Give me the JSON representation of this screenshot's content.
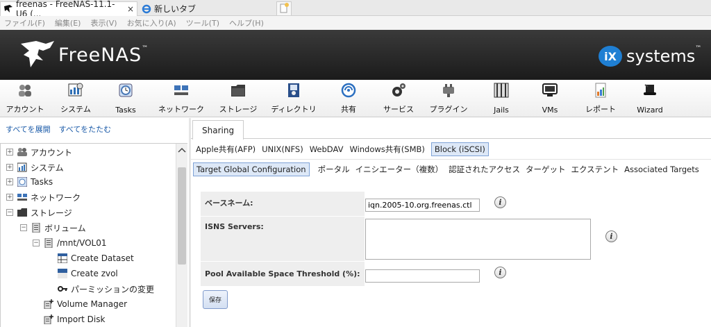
{
  "browser": {
    "tabs": [
      {
        "title": "freenas - FreeNAS-11.1-U6 (...",
        "close": "×"
      },
      {
        "title": "新しいタブ"
      }
    ],
    "menu": [
      "ファイル(F)",
      "編集(E)",
      "表示(V)",
      "お気に入り(A)",
      "ツール(T)",
      "ヘルプ(H)"
    ]
  },
  "header": {
    "logo_text": "FreeNAS",
    "tm": "™",
    "brand_ix": "iX",
    "brand_text": "systems",
    "brand_tm": "™"
  },
  "toolbar": {
    "buttons": [
      {
        "label": "アカウント",
        "icon": "users-icon"
      },
      {
        "label": "システム",
        "icon": "system-icon"
      },
      {
        "label": "Tasks",
        "icon": "tasks-icon"
      },
      {
        "label": "ネットワーク",
        "icon": "network-icon"
      },
      {
        "label": "ストレージ",
        "icon": "storage-icon"
      },
      {
        "label": "ディレクトリ",
        "icon": "directory-icon"
      },
      {
        "label": "共有",
        "icon": "sharing-icon"
      },
      {
        "label": "サービス",
        "icon": "services-icon"
      },
      {
        "label": "プラグイン",
        "icon": "plugins-icon"
      },
      {
        "label": "Jails",
        "icon": "jails-icon"
      },
      {
        "label": "VMs",
        "icon": "vms-icon"
      },
      {
        "label": "レポート",
        "icon": "reports-icon"
      },
      {
        "label": "Wizard",
        "icon": "wizard-icon"
      }
    ]
  },
  "sidebar": {
    "expand_all": "すべてを展開",
    "collapse_all": "すべてをたたむ",
    "tree": [
      {
        "label": "アカウント",
        "toggle": "+"
      },
      {
        "label": "システム",
        "toggle": "+"
      },
      {
        "label": "Tasks",
        "toggle": "+"
      },
      {
        "label": "ネットワーク",
        "toggle": "+"
      },
      {
        "label": "ストレージ",
        "toggle": "−"
      },
      {
        "label": "ボリューム",
        "toggle": "−"
      },
      {
        "label": "/mnt/VOL01",
        "toggle": "−"
      },
      {
        "label": "Create Dataset"
      },
      {
        "label": "Create zvol"
      },
      {
        "label": "パーミッションの変更"
      },
      {
        "label": "Volume Manager"
      },
      {
        "label": "Import Disk"
      }
    ]
  },
  "main": {
    "tab": "Sharing",
    "share_tabs": [
      "Apple共有(AFP)",
      "UNIX(NFS)",
      "WebDAV",
      "Windows共有(SMB)",
      "Block (iSCSI)"
    ],
    "share_tab_selected": "Block (iSCSI)",
    "iscsi_tabs": [
      "Target Global Configuration",
      "ポータル",
      "イニシエーター（複数）",
      "認証されたアクセス",
      "ターゲット",
      "エクステント",
      "Associated Targets"
    ],
    "iscsi_tab_selected": "Target Global Configuration",
    "form": {
      "base_name_label": "ベースネーム:",
      "base_name_value": "iqn.2005-10.org.freenas.ctl",
      "isns_label": "ISNS Servers:",
      "isns_value": "",
      "pool_threshold_label": "Pool Available Space Threshold (%):",
      "pool_threshold_value": "",
      "info_glyph": "i",
      "save_label": "保存"
    }
  }
}
